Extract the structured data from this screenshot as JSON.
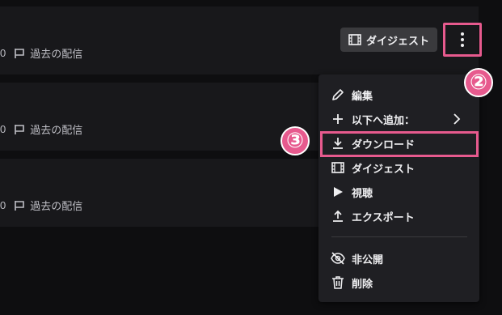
{
  "rows": [
    {
      "count": "0",
      "label": "過去の配信"
    },
    {
      "count": "0",
      "label": "過去の配信"
    },
    {
      "count": "0",
      "label": "過去の配信"
    }
  ],
  "digest_button": {
    "label": "ダイジェスト",
    "icon": "film-icon"
  },
  "more_button": {
    "icon": "more-vertical-icon"
  },
  "annotations": {
    "badge2": "②",
    "badge3": "③",
    "highlight_color": "#e75a8e"
  },
  "menu": {
    "items": [
      {
        "label": "編集",
        "icon": "pencil-icon"
      },
      {
        "label": "以下へ追加：",
        "icon": "plus-icon",
        "has_submenu": true
      },
      {
        "label": "ダウンロード",
        "icon": "download-icon"
      },
      {
        "label": "ダイジェスト",
        "icon": "film-icon"
      },
      {
        "label": "視聴",
        "icon": "play-icon"
      },
      {
        "label": "エクスポート",
        "icon": "upload-icon"
      },
      {
        "label": "非公開",
        "icon": "eye-off-icon"
      },
      {
        "label": "削除",
        "icon": "trash-icon"
      }
    ]
  },
  "colors": {
    "background": "#0e0e10",
    "row": "#18181b",
    "menu": "#1f1f23",
    "accent_pink": "#e75a8e"
  }
}
